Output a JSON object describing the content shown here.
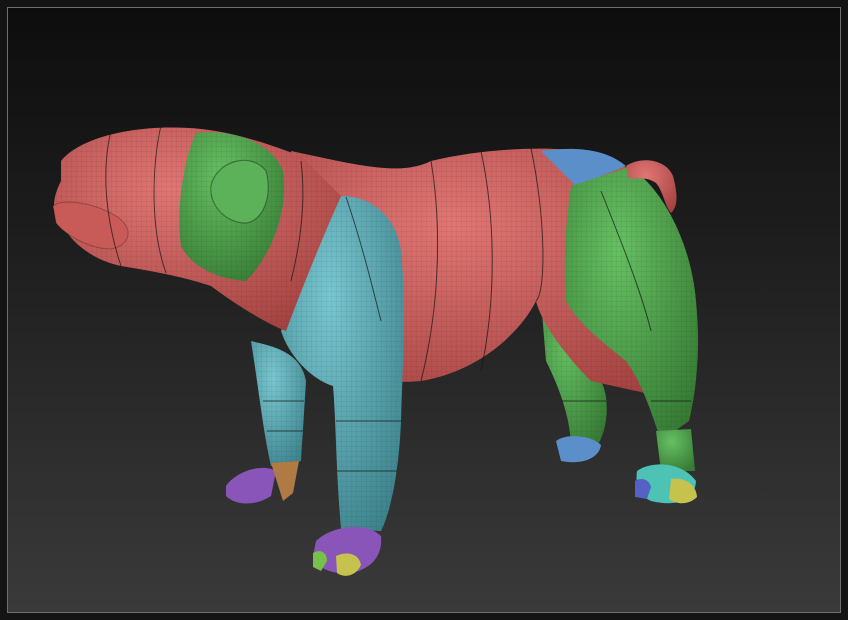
{
  "viewport": {
    "subject": "dog-mesh",
    "polygroup_colors": {
      "red": "#c85a58",
      "green": "#4fa14c",
      "cyan": "#5aa9b4",
      "blue": "#5b8fc9",
      "purple": "#8a55b8",
      "yellow": "#c6c24e",
      "orange": "#b07a45",
      "lime": "#78c04c",
      "teal": "#4cc3b4",
      "indigo": "#5561c4"
    },
    "background_top": "#0d0d0d",
    "background_bottom": "#3a3a3a",
    "frame_color": "#6e6e6e"
  }
}
